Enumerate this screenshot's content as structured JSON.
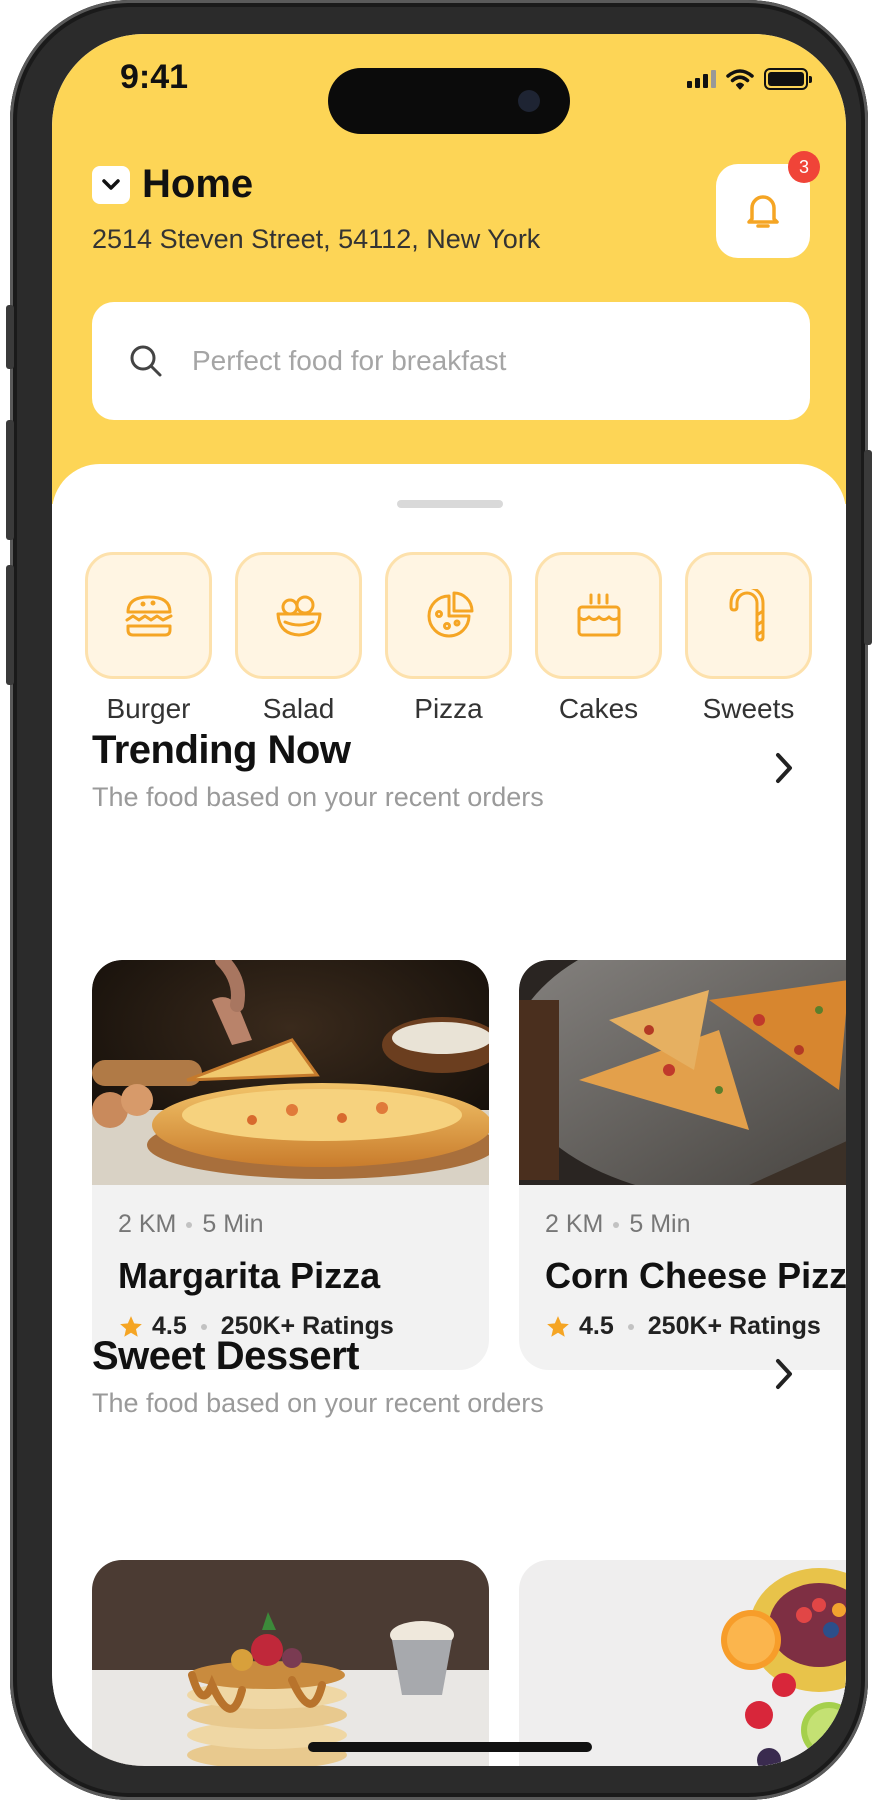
{
  "status_bar": {
    "time": "9:41"
  },
  "header": {
    "location_title": "Home",
    "address": "2514 Steven Street, 54112, New York",
    "notification_count": "3"
  },
  "search": {
    "placeholder": "Perfect food for breakfast"
  },
  "categories": [
    {
      "label": "Burger",
      "icon": "burger-icon"
    },
    {
      "label": "Salad",
      "icon": "salad-bowl-icon"
    },
    {
      "label": "Pizza",
      "icon": "pizza-icon"
    },
    {
      "label": "Cakes",
      "icon": "cake-icon"
    },
    {
      "label": "Sweets",
      "icon": "candy-cane-icon"
    }
  ],
  "trending": {
    "title": "Trending Now",
    "subtitle": "The food based on your recent orders",
    "items": [
      {
        "distance": "2 KM",
        "time": "5 Min",
        "name": "Margarita Pizza",
        "rating": "4.5",
        "ratings_count": "250K+ Ratings"
      },
      {
        "distance": "2 KM",
        "time": "5 Min",
        "name": "Corn Cheese Pizza",
        "rating": "4.5",
        "ratings_count": "250K+ Ratings"
      }
    ]
  },
  "dessert": {
    "title": "Sweet Dessert",
    "subtitle": "The food based on your recent orders"
  },
  "colors": {
    "header_bg": "#fdd556",
    "accent": "#f5a524",
    "category_bg": "#fff5e3",
    "badge": "#f04438"
  }
}
